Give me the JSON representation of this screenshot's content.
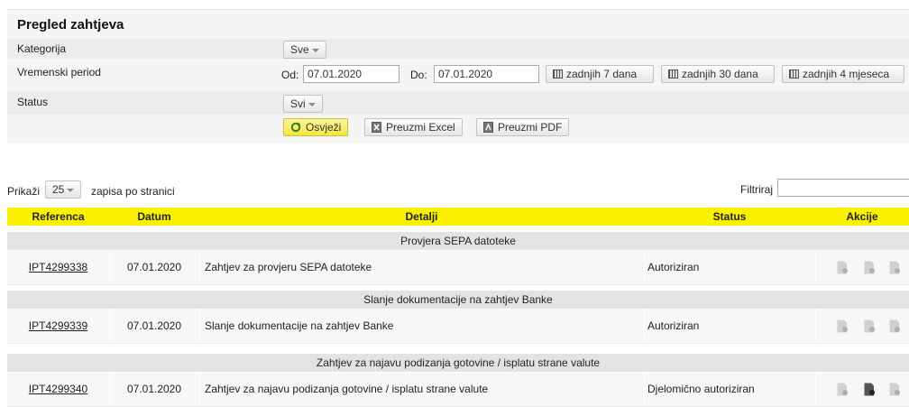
{
  "panel": {
    "title": "Pregled zahtjeva",
    "category_label": "Kategorija",
    "category_value": "Sve",
    "period_label": "Vremenski period",
    "from_label": "Od:",
    "from_value": "07.01.2020",
    "to_label": "Do:",
    "to_value": "07.01.2020",
    "last7": "zadnjih 7 dana",
    "last30": "zadnjih 30 dana",
    "last4m": "zadnjih 4 mjeseca",
    "status_label": "Status",
    "status_value": "Svi",
    "refresh": "Osvježi",
    "excel": "Preuzmi Excel",
    "pdf": "Preuzmi PDF"
  },
  "list": {
    "show_label": "Prikaži",
    "page_size": "25",
    "per_page_label": "zapisa po stranici",
    "filter_label": "Filtriraj",
    "filter_value": ""
  },
  "table": {
    "headers": [
      "Referenca",
      "Datum",
      "Detalji",
      "Status",
      "Akcije"
    ],
    "groups": [
      {
        "title": "Provjera SEPA datoteke",
        "row": {
          "ref": "IPT4299338",
          "date": "07.01.2020",
          "details": "Zahtjev za provjeru SEPA datoteke",
          "status": "Autoriziran"
        }
      },
      {
        "title": "Slanje dokumentacije na zahtjev Banke",
        "row": {
          "ref": "IPT4299339",
          "date": "07.01.2020",
          "details": "Slanje dokumentacije na zahtjev Banke",
          "status": "Autoriziran"
        }
      },
      {
        "title": "Zahtjev za najavu podizanja gotovine / isplatu strane valute",
        "row": {
          "ref": "IPT4299340",
          "date": "07.01.2020",
          "details": "Zahtjev za najavu podizanja gotovine / isplatu strane valute",
          "status": "Djelomično autoriziran"
        }
      }
    ]
  },
  "colors": {
    "header_yellow": "#fbf000",
    "refresh_yellow": "#f1e645",
    "group_band": "#e3e3e3"
  },
  "icons": [
    "calendar-icon",
    "refresh-icon",
    "excel-icon",
    "pdf-icon",
    "document-action-icon"
  ]
}
